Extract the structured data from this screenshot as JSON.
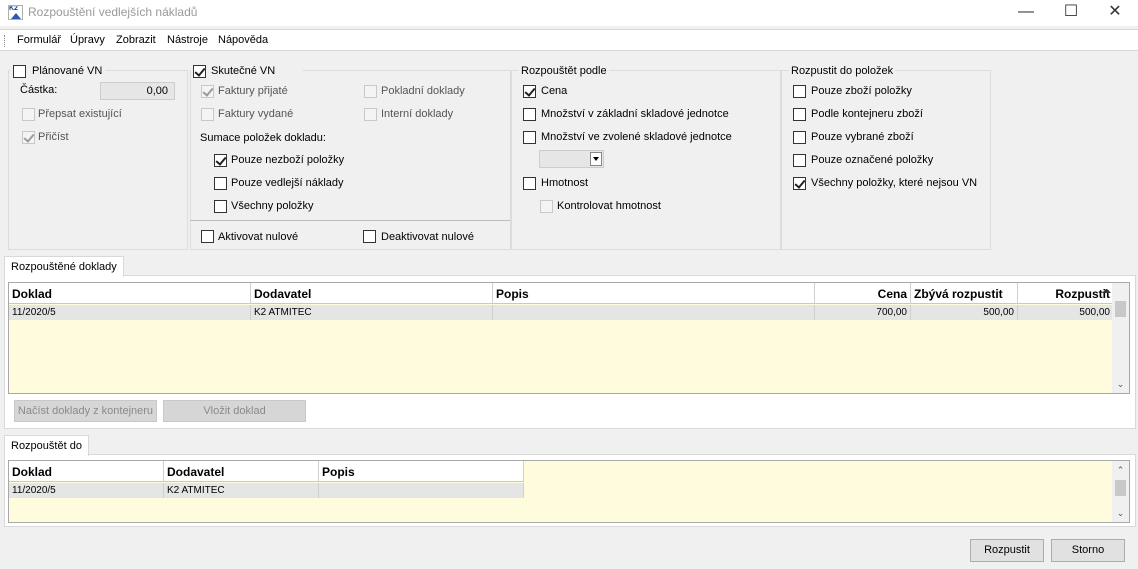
{
  "window": {
    "title": "Rozpouštění vedlejších nákladů",
    "app_icon_text": "K2",
    "minimize_glyph": "—",
    "maximize_glyph": "☐",
    "close_glyph": "✕"
  },
  "menu": [
    "Formulář",
    "Úpravy",
    "Zobrazit",
    "Nástroje",
    "Nápověda"
  ],
  "planovane": {
    "label": "Plánované VN",
    "castka_label": "Částka:",
    "castka_value": "0,00",
    "prepsat_label": "Přepsat existující",
    "pricist_label": "Přičíst"
  },
  "skutecne": {
    "label": "Skutečné VN",
    "faktury_prijate": "Faktury přijaté",
    "faktury_vydane": "Faktury vydané",
    "pokladni_doklady": "Pokladní doklady",
    "interni_doklady": "Interní doklady",
    "sumace_label": "Sumace položek dokladu:",
    "pouze_nezbozni": "Pouze nezboží položky",
    "pouze_vedlejsi": "Pouze vedlejší náklady",
    "vsechny_polozky": "Všechny položky",
    "aktivovat_nulove": "Aktivovat nulové",
    "deaktivovat_nulove": "Deaktivovat nulové"
  },
  "rozpoustet_podle": {
    "legend": "Rozpouštět podle",
    "cena": "Cena",
    "mnozstvi_zakladni": "Množství v základní skladové jednotce",
    "mnozstvi_zvolene": "Množství ve zvolené skladové jednotce",
    "hmotnost": "Hmotnost",
    "kontrolovat_hmotnost": "Kontrolovat hmotnost"
  },
  "rozpustit_do_polozek": {
    "legend": "Rozpustit do položek",
    "pouze_zbozni": "Pouze zboží položky",
    "podle_kontejneru": "Podle kontejneru zboží",
    "pouze_vybrane": "Pouze vybrané zboží",
    "pouze_oznacene": "Pouze označené položky",
    "vsechny_nejsou_vn": "Všechny položky, které nejsou VN"
  },
  "rozpustene_doklady": {
    "tab": "Rozpouštěné doklady",
    "columns": [
      "Doklad",
      "Dodavatel",
      "Popis",
      "Cena",
      "Zbývá rozpustit",
      "Rozpustit"
    ],
    "rows": [
      [
        "11/2020/5",
        "K2 ATMITEC",
        "",
        "700,00",
        "500,00",
        "500,00"
      ]
    ],
    "btn_nacist": "Načíst doklady z kontejneru",
    "btn_vlozit": "Vložit doklad"
  },
  "rozpoustet_do": {
    "tab": "Rozpouštět do",
    "columns": [
      "Doklad",
      "Dodavatel",
      "Popis"
    ],
    "rows": [
      [
        "11/2020/5",
        "K2 ATMITEC",
        ""
      ]
    ]
  },
  "footer": {
    "rozpustit": "Rozpustit",
    "storno": "Storno"
  }
}
